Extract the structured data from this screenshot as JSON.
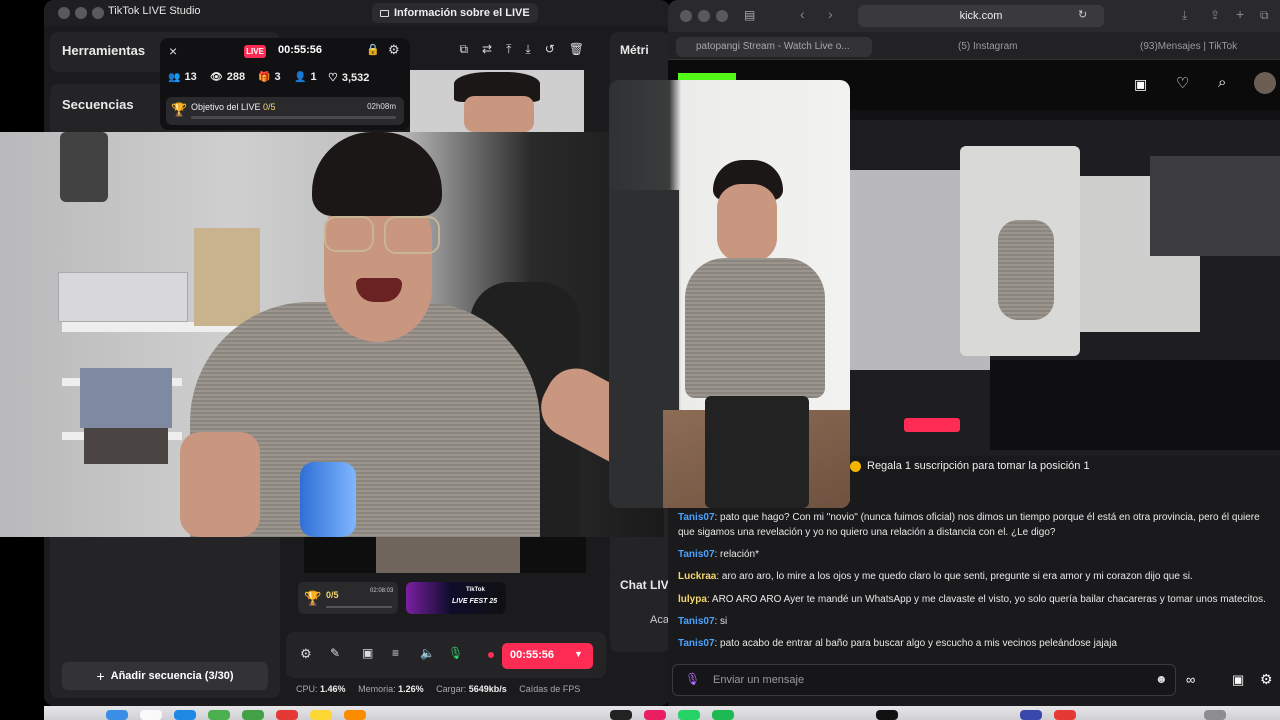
{
  "studio": {
    "app_title": "TikTok LIVE Studio",
    "live_info_button": "Información sobre el LIVE",
    "tools_title": "Herramientas",
    "sequences_title": "Secuencias",
    "metrics_title": "Métri",
    "chat_title": "Chat LIV",
    "chat_snippet": "Aca",
    "add_sequence": "Añadir secuencia (3/30)",
    "live_badge": "LIVE",
    "live_timer": "00:55:56",
    "stats": {
      "viewers": "13",
      "views": "288",
      "gifts": "3",
      "new_followers": "1",
      "likes": "3,532"
    },
    "goal": {
      "label_prefix": "Objetivo del LIVE ",
      "progress": "0/5",
      "time": "02h08m",
      "fraction": 0
    },
    "goal_small": {
      "progress": "0/5",
      "time": "02:08:03"
    },
    "promo": {
      "title": "TikTok",
      "subtitle": "LIVE FEST 25"
    },
    "control_timer": "00:55:56",
    "stats_bar": {
      "cpu_label": "CPU:",
      "cpu_value": "1.46%",
      "mem_label": "Memoria:",
      "mem_value": "1.26%",
      "load_label": "Cargar:",
      "load_value": "5649kb/s",
      "fps_label": "Caídas de FPS"
    }
  },
  "browser": {
    "url": "kick.com",
    "tabs": [
      "patopangi Stream - Watch Live o...",
      "(5) Instagram",
      "(93)Mensajes | TikTok"
    ],
    "subscription_banner": "Regala 1 suscripción para tomar la posición 1",
    "chat_placeholder": "Enviar un mensaje",
    "chat": [
      {
        "user": "Tanis07",
        "color": "#4aa3ff",
        "text": ": pato que hago? Con mi \"novio\" (nunca fuimos oficial) nos dimos un tiempo porque él está en otra provincia, pero él quiere que sigamos una revelación y yo no quiero una relación a distancia con el. ¿Le digo?"
      },
      {
        "user": "Tanis07",
        "color": "#4aa3ff",
        "text": ": relación*"
      },
      {
        "user": "Luckraa",
        "color": "#f5d76e",
        "text": ": aro aro aro, lo mire a los ojos y me quedo claro lo que senti, pregunte si era amor y mi corazon dijo que si."
      },
      {
        "user": "lulypa",
        "color": "#f5d76e",
        "text": ": ARO ARO ARO Ayer te mandé un WhatsApp y me clavaste el visto, yo solo quería bailar chacareras y tomar unos matecitos."
      },
      {
        "user": "Tanis07",
        "color": "#4aa3ff",
        "text": ": si"
      },
      {
        "user": "Tanis07",
        "color": "#4aa3ff",
        "text": ": pato acabo de entrar al baño para buscar algo y escucho a mis vecinos peleándose jajaja"
      }
    ]
  },
  "colors": {
    "tiktok_red": "#fe2c55",
    "kick_green": "#53fc18",
    "chat_blue": "#4aa3ff",
    "chat_yellow": "#f5d76e"
  }
}
